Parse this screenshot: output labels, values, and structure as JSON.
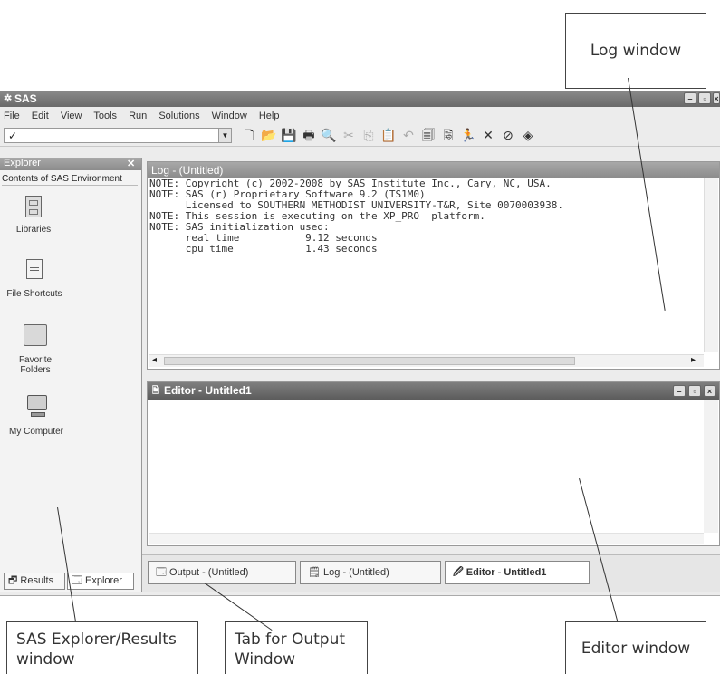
{
  "callouts": {
    "log": "Log window",
    "explorer": "SAS Explorer/Results window",
    "output_tab": "Tab for Output Window",
    "editor": "Editor window"
  },
  "app": {
    "title": "SAS"
  },
  "menu": [
    "File",
    "Edit",
    "View",
    "Tools",
    "Run",
    "Solutions",
    "Window",
    "Help"
  ],
  "toolbar": {
    "check": "✓"
  },
  "explorer": {
    "title": "Explorer",
    "heading": "Contents of SAS Environment",
    "items": [
      "Libraries",
      "File Shortcuts",
      "Favorite Folders",
      "My Computer"
    ],
    "tabs": [
      "Results",
      "Explorer"
    ]
  },
  "log": {
    "title": "Log - (Untitled)",
    "lines": [
      "NOTE: Copyright (c) 2002-2008 by SAS Institute Inc., Cary, NC, USA.",
      "NOTE: SAS (r) Proprietary Software 9.2 (TS1M0)",
      "      Licensed to SOUTHERN METHODIST UNIVERSITY-T&R, Site 0070003938.",
      "NOTE: This session is executing on the XP_PRO  platform.",
      "",
      "",
      "",
      "NOTE: SAS initialization used:",
      "      real time           9.12 seconds",
      "      cpu time            1.43 seconds"
    ]
  },
  "editor": {
    "title": "Editor - Untitled1"
  },
  "bottom_tabs": [
    "Output - (Untitled)",
    "Log - (Untitled)",
    "Editor - Untitled1"
  ]
}
